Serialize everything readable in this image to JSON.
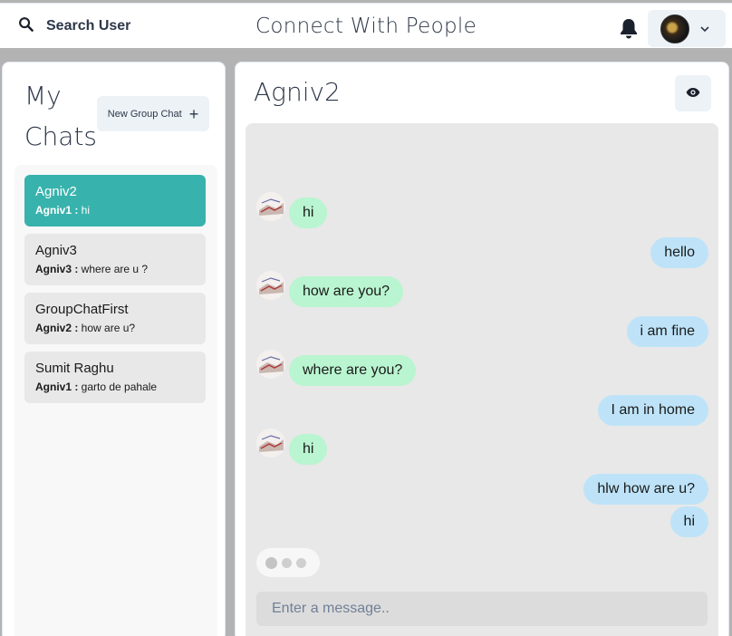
{
  "header": {
    "search_label": "Search User",
    "app_title": "Connect With People",
    "search_icon": "search-icon",
    "bell_icon": "bell-icon",
    "chevron_icon": "chevron-down-icon"
  },
  "sidebar": {
    "title": "My Chats",
    "new_group_label": "New Group Chat",
    "plus_icon": "plus-icon",
    "chats": [
      {
        "name": "Agniv2",
        "sender": "Agniv1 :",
        "preview": " hi",
        "active": true
      },
      {
        "name": "Agniv3",
        "sender": "Agniv3 :",
        "preview": " where are u ?",
        "active": false
      },
      {
        "name": "GroupChatFirst",
        "sender": "Agniv2 :",
        "preview": " how are u?",
        "active": false
      },
      {
        "name": "Sumit Raghu",
        "sender": "Agniv1 :",
        "preview": " garto de pahale",
        "active": false
      }
    ]
  },
  "chat": {
    "title": "Agniv2",
    "eye_icon": "eye-icon",
    "input_placeholder": "Enter a message..",
    "messages": [
      {
        "text": "hi",
        "dir": "in"
      },
      {
        "text": "hello",
        "dir": "out"
      },
      {
        "text": "how are you?",
        "dir": "in"
      },
      {
        "text": "i am fine",
        "dir": "out"
      },
      {
        "text": "where are you?",
        "dir": "in"
      },
      {
        "text": "I am in home",
        "dir": "out"
      },
      {
        "text": "hi",
        "dir": "in"
      },
      {
        "text": "hlw how are u?",
        "dir": "out"
      },
      {
        "text": "hi",
        "dir": "out"
      }
    ]
  },
  "colors": {
    "active_chat": "#38b2ac",
    "incoming_bubble": "#b9f5d0",
    "outgoing_bubble": "#bee3f8"
  }
}
